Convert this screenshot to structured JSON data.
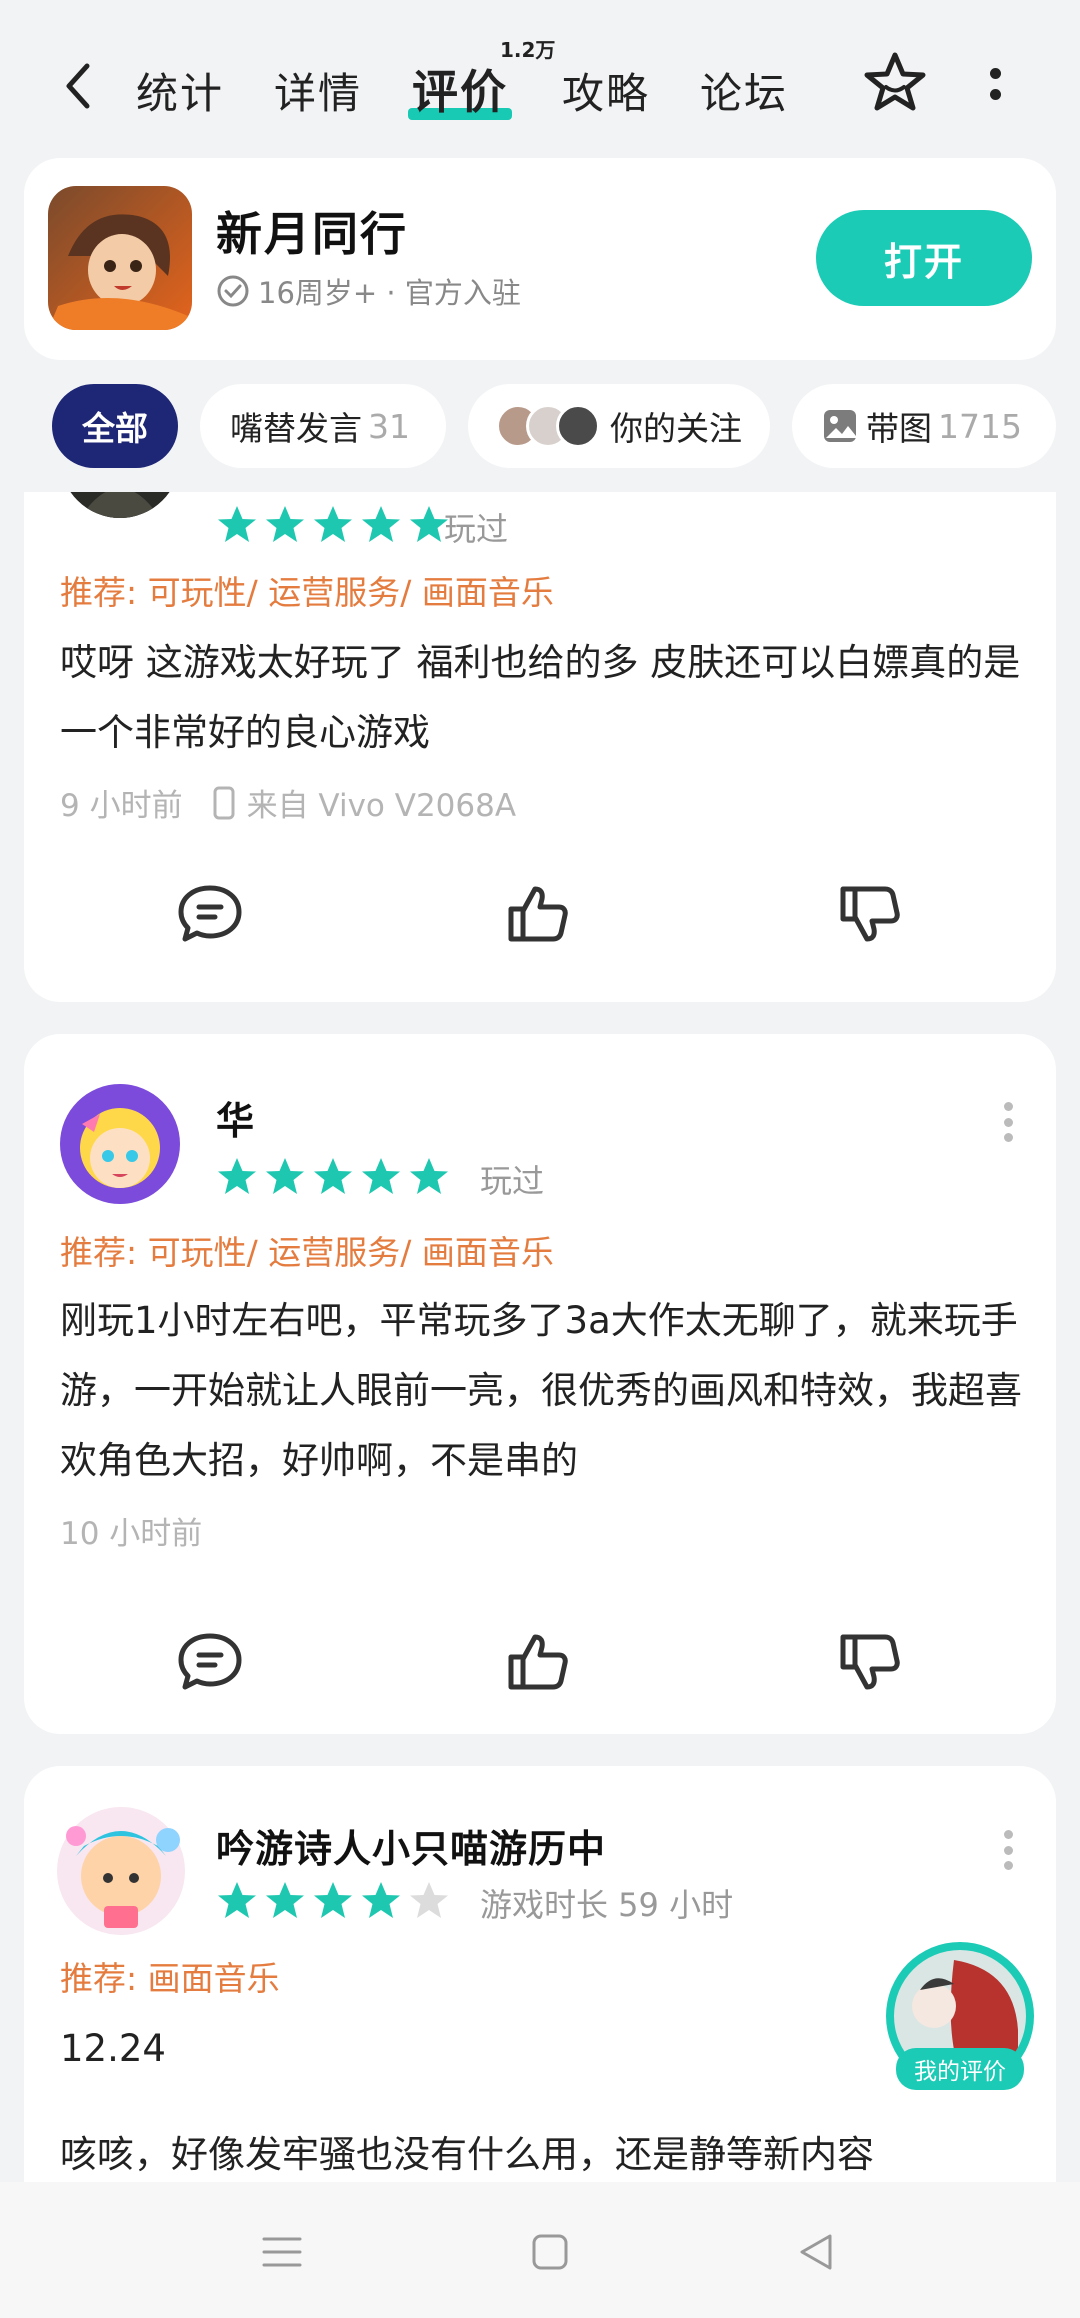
{
  "nav": {
    "tabs": [
      "统计",
      "详情",
      "评价",
      "攻略",
      "论坛"
    ],
    "active_tab_badge": "1.2万"
  },
  "app": {
    "name": "新月同行",
    "meta": "16周岁+ · 官方入驻",
    "open_label": "打开"
  },
  "filters": {
    "all": "全部",
    "chip2_label": "嘴替发言",
    "chip2_count": "31",
    "chip3_label": "你的关注",
    "chip4_label": "带图",
    "chip4_count": "1715"
  },
  "reviews": [
    {
      "rating": 5,
      "status": "玩过",
      "recommend": "推荐: 可玩性/ 运营服务/ 画面音乐",
      "text": "哎呀 这游戏太好玩了 福利也给的多 皮肤还可以白嫖真的是一个非常好的良心游戏",
      "time": "9 小时前",
      "device": "来自 Vivo V2068A"
    },
    {
      "name": "华",
      "rating": 5,
      "status": "玩过",
      "recommend": "推荐: 可玩性/ 运营服务/ 画面音乐",
      "text": "刚玩1小时左右吧，平常玩多了3a大作太无聊了，就来玩手游，一开始就让人眼前一亮，很优秀的画风和特效，我超喜欢角色大招，好帅啊，不是串的",
      "time": "10 小时前"
    },
    {
      "name": "吟游诗人小只喵游历中",
      "rating": 4,
      "status": "游戏时长 59 小时",
      "recommend": "推荐: 画面音乐",
      "text_line1": "12.24",
      "text_line2": "咳咳，好像发牢骚也没有什么用，还是静等新内容"
    }
  ],
  "floating": {
    "my_review": "我的评价"
  },
  "colors": {
    "accent": "#1bcbb5",
    "active_chip": "#1e2676",
    "recommend": "#e57c3f"
  },
  "icons": [
    "back-icon",
    "star-outline-icon",
    "more-icon",
    "verified-icon",
    "comment-icon",
    "thumbs-up-icon",
    "thumbs-down-icon",
    "phone-icon",
    "image-icon",
    "menu-icon",
    "square-icon",
    "triangle-back-icon"
  ]
}
